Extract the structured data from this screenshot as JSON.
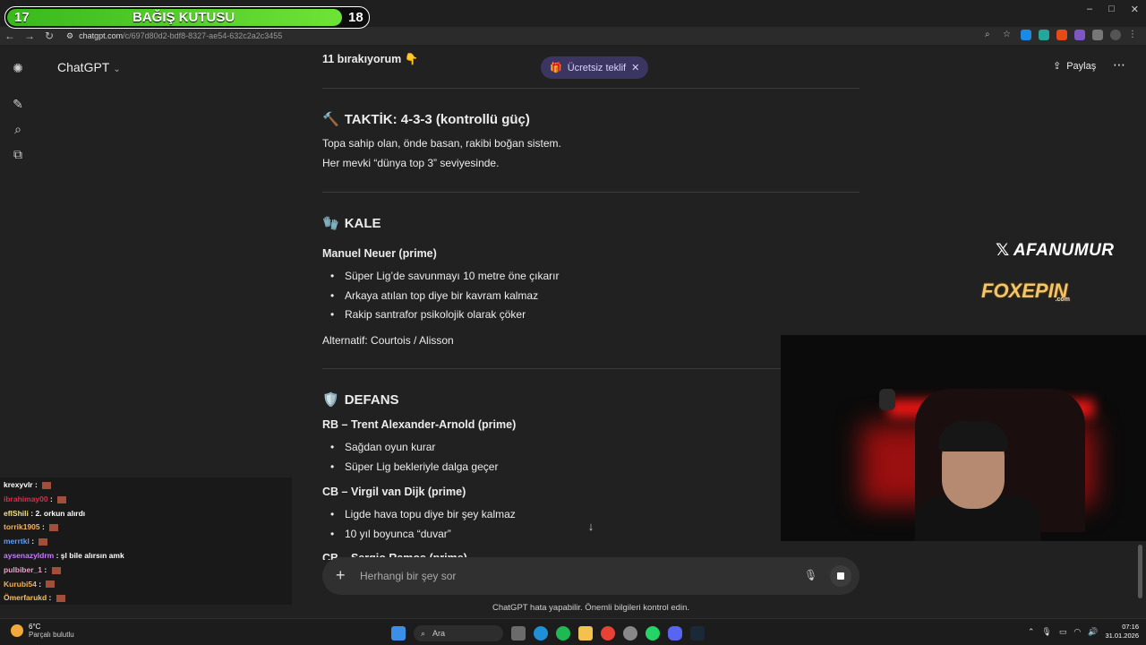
{
  "browser": {
    "url_host": "chatgpt.com",
    "url_path": "/c/697d80d2-bdf8-8327-ae54-632c2a2c3455",
    "win_min": "–",
    "win_max": "□",
    "win_close": "✕"
  },
  "donation": {
    "left": "17",
    "label": "BAĞIŞ KUTUSU",
    "right": "18",
    "progress_fraction": 0.93
  },
  "header": {
    "model": "ChatGPT",
    "offer": "Ücretsiz teklif",
    "share": "Paylaş"
  },
  "content": {
    "top_line": "11 bırakıyorum 👇",
    "tactic_title": "TAKTİK: 4-3-3 (kontrollü güç)",
    "tactic_p1": "Topa sahip olan, önde basan, rakibi boğan sistem.",
    "tactic_p2": "Her mevki “dünya top 3” seviyesinde.",
    "kale_title": "KALE",
    "gk_name": "Manuel Neuer (prime)",
    "gk_bullets": [
      "Süper Lig’de savunmayı 10 metre öne çıkarır",
      "Arkaya atılan top diye bir kavram kalmaz",
      "Rakip santrafor psikolojik olarak çöker"
    ],
    "gk_alt": "Alternatif: Courtois / Alisson",
    "defans_title": "DEFANS",
    "rb_name": "RB – Trent Alexander-Arnold (prime)",
    "rb_bullets": [
      "Sağdan oyun kurar",
      "Süper Lig bekleriyle dalga geçer"
    ],
    "cb_name": "CB – Virgil van Dijk (prime)",
    "cb_bullets": [
      "Ligde hava topu diye bir şey kalmaz",
      "10 yıl boyunca “duvar”"
    ],
    "cut_line": "CB – Sergio Ramos (prime)"
  },
  "composer": {
    "placeholder": "Herhangi bir şey sor",
    "disclaimer": "ChatGPT hata yapabilir. Önemli bilgileri kontrol edin."
  },
  "chat": [
    {
      "user": "krexyvlr",
      "color": "#ffffff",
      "msg": ""
    },
    {
      "user": "ibrahimay00",
      "color": "#d0314b",
      "msg": ""
    },
    {
      "user": "eflShili",
      "color": "#f0e08a",
      "msg": "2. orkun alırdı"
    },
    {
      "user": "torrik1905",
      "color": "#f5b25c",
      "msg": ""
    },
    {
      "user": "merrtkl",
      "color": "#5b9dff",
      "msg": ""
    },
    {
      "user": "aysenazyldrm",
      "color": "#c87cff",
      "msg": "şl bile alırsın amk"
    },
    {
      "user": "pulbiber_1",
      "color": "#e8a0c8",
      "msg": ""
    },
    {
      "user": "Kurubi54",
      "color": "#f3b04d",
      "msg": ""
    },
    {
      "user": "Ömerfarukd",
      "color": "#f7c05a",
      "msg": ""
    }
  ],
  "branding": {
    "x_handle": "AFANUMUR",
    "sponsor": "FOXEPIN",
    "sponsor_suffix": ".com"
  },
  "taskbar": {
    "temp": "6°C",
    "weather": "Parçalı bulutlu",
    "search": "Ara",
    "time": "07:16",
    "date": "31.01.2026"
  },
  "colors": {
    "accent_offer_bg": "#3a3561",
    "donation_green": "#4fcf28",
    "page_bg": "#212121"
  }
}
